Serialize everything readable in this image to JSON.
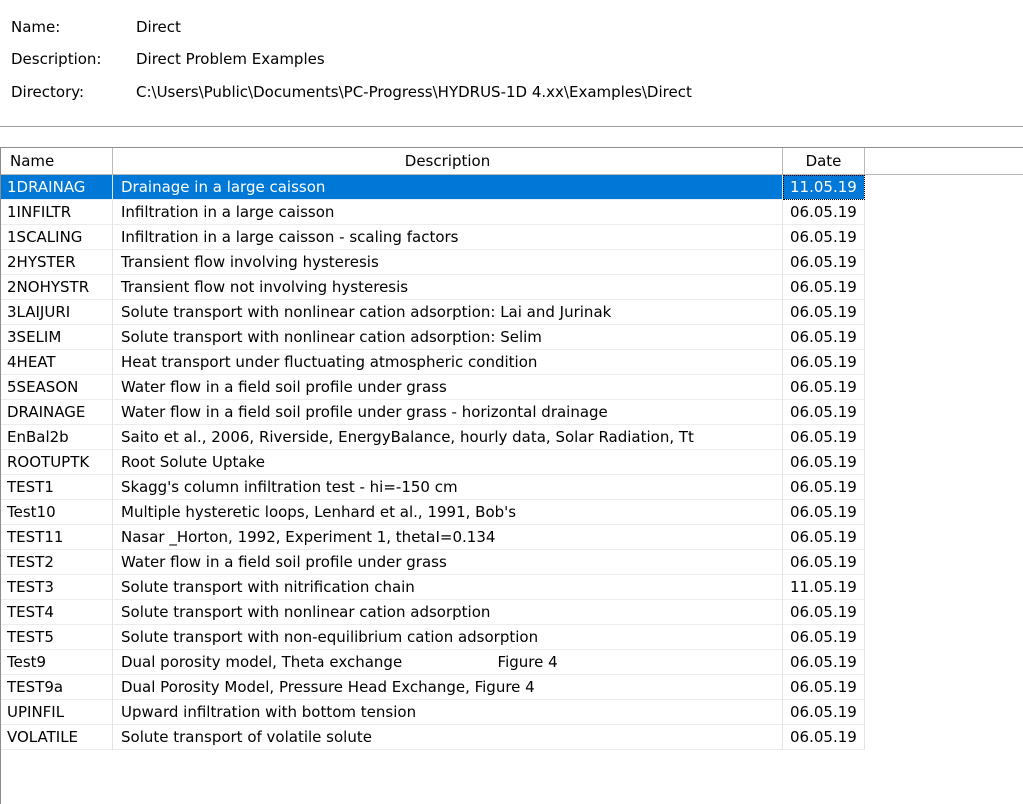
{
  "info": {
    "name_label": "Name:",
    "name_value": "Direct",
    "description_label": "Description:",
    "description_value": "Direct Problem Examples",
    "directory_label": "Directory:",
    "directory_value": "C:\\Users\\Public\\Documents\\PC-Progress\\HYDRUS-1D 4.xx\\Examples\\Direct"
  },
  "table": {
    "columns": {
      "name": "Name",
      "description": "Description",
      "date": "Date"
    },
    "selected_index": 0,
    "rows": [
      {
        "name": "1DRAINAG",
        "description": "Drainage in a large caisson",
        "date": "11.05.19"
      },
      {
        "name": "1INFILTR",
        "description": "Infiltration in a large caisson",
        "date": "06.05.19"
      },
      {
        "name": "1SCALING",
        "description": "Infiltration in a large caisson - scaling factors",
        "date": "06.05.19"
      },
      {
        "name": "2HYSTER",
        "description": "Transient flow involving hysteresis",
        "date": "06.05.19"
      },
      {
        "name": "2NOHYSTR",
        "description": "Transient flow not involving hysteresis",
        "date": "06.05.19"
      },
      {
        "name": "3LAIJURI",
        "description": "Solute transport with nonlinear cation adsorption: Lai and Jurinak",
        "date": "06.05.19"
      },
      {
        "name": "3SELIM",
        "description": "Solute transport with nonlinear cation adsorption: Selim",
        "date": "06.05.19"
      },
      {
        "name": "4HEAT",
        "description": "Heat transport under fluctuating atmospheric condition",
        "date": "06.05.19"
      },
      {
        "name": "5SEASON",
        "description": "Water flow in a field soil profile under grass",
        "date": "06.05.19"
      },
      {
        "name": "DRAINAGE",
        "description": "Water flow in a field soil profile under grass - horizontal drainage",
        "date": "06.05.19"
      },
      {
        "name": "EnBal2b",
        "description": "Saito et al., 2006, Riverside, EnergyBalance, hourly data, Solar Radiation, Tt",
        "date": "06.05.19"
      },
      {
        "name": "ROOTUPTK",
        "description": "Root Solute Uptake",
        "date": "06.05.19"
      },
      {
        "name": "TEST1",
        "description": "Skagg's column infiltration test - hi=-150 cm",
        "date": "06.05.19"
      },
      {
        "name": "Test10",
        "description": "Multiple hysteretic loops, Lenhard et al., 1991, Bob's",
        "date": "06.05.19"
      },
      {
        "name": "TEST11",
        "description": "Nasar _Horton, 1992, Experiment 1, thetaI=0.134",
        "date": "06.05.19"
      },
      {
        "name": "TEST2",
        "description": "Water flow in a field soil profile under grass",
        "date": "06.05.19"
      },
      {
        "name": "TEST3",
        "description": "Solute transport with nitrification chain",
        "date": "11.05.19"
      },
      {
        "name": "TEST4",
        "description": "Solute transport with nonlinear cation adsorption",
        "date": "06.05.19"
      },
      {
        "name": "TEST5",
        "description": "Solute transport with non-equilibrium cation adsorption",
        "date": "06.05.19"
      },
      {
        "name": "Test9",
        "description": "Dual porosity model, Theta exchange                    Figure 4",
        "date": "06.05.19"
      },
      {
        "name": "TEST9a",
        "description": "Dual Porosity Model, Pressure Head Exchange, Figure 4",
        "date": "06.05.19"
      },
      {
        "name": "UPINFIL",
        "description": "Upward infiltration with bottom tension",
        "date": "06.05.19"
      },
      {
        "name": "VOLATILE",
        "description": "Solute transport of volatile solute",
        "date": "06.05.19"
      }
    ]
  },
  "colors": {
    "selection": "#0078d7",
    "selection_text": "#ffffff"
  }
}
